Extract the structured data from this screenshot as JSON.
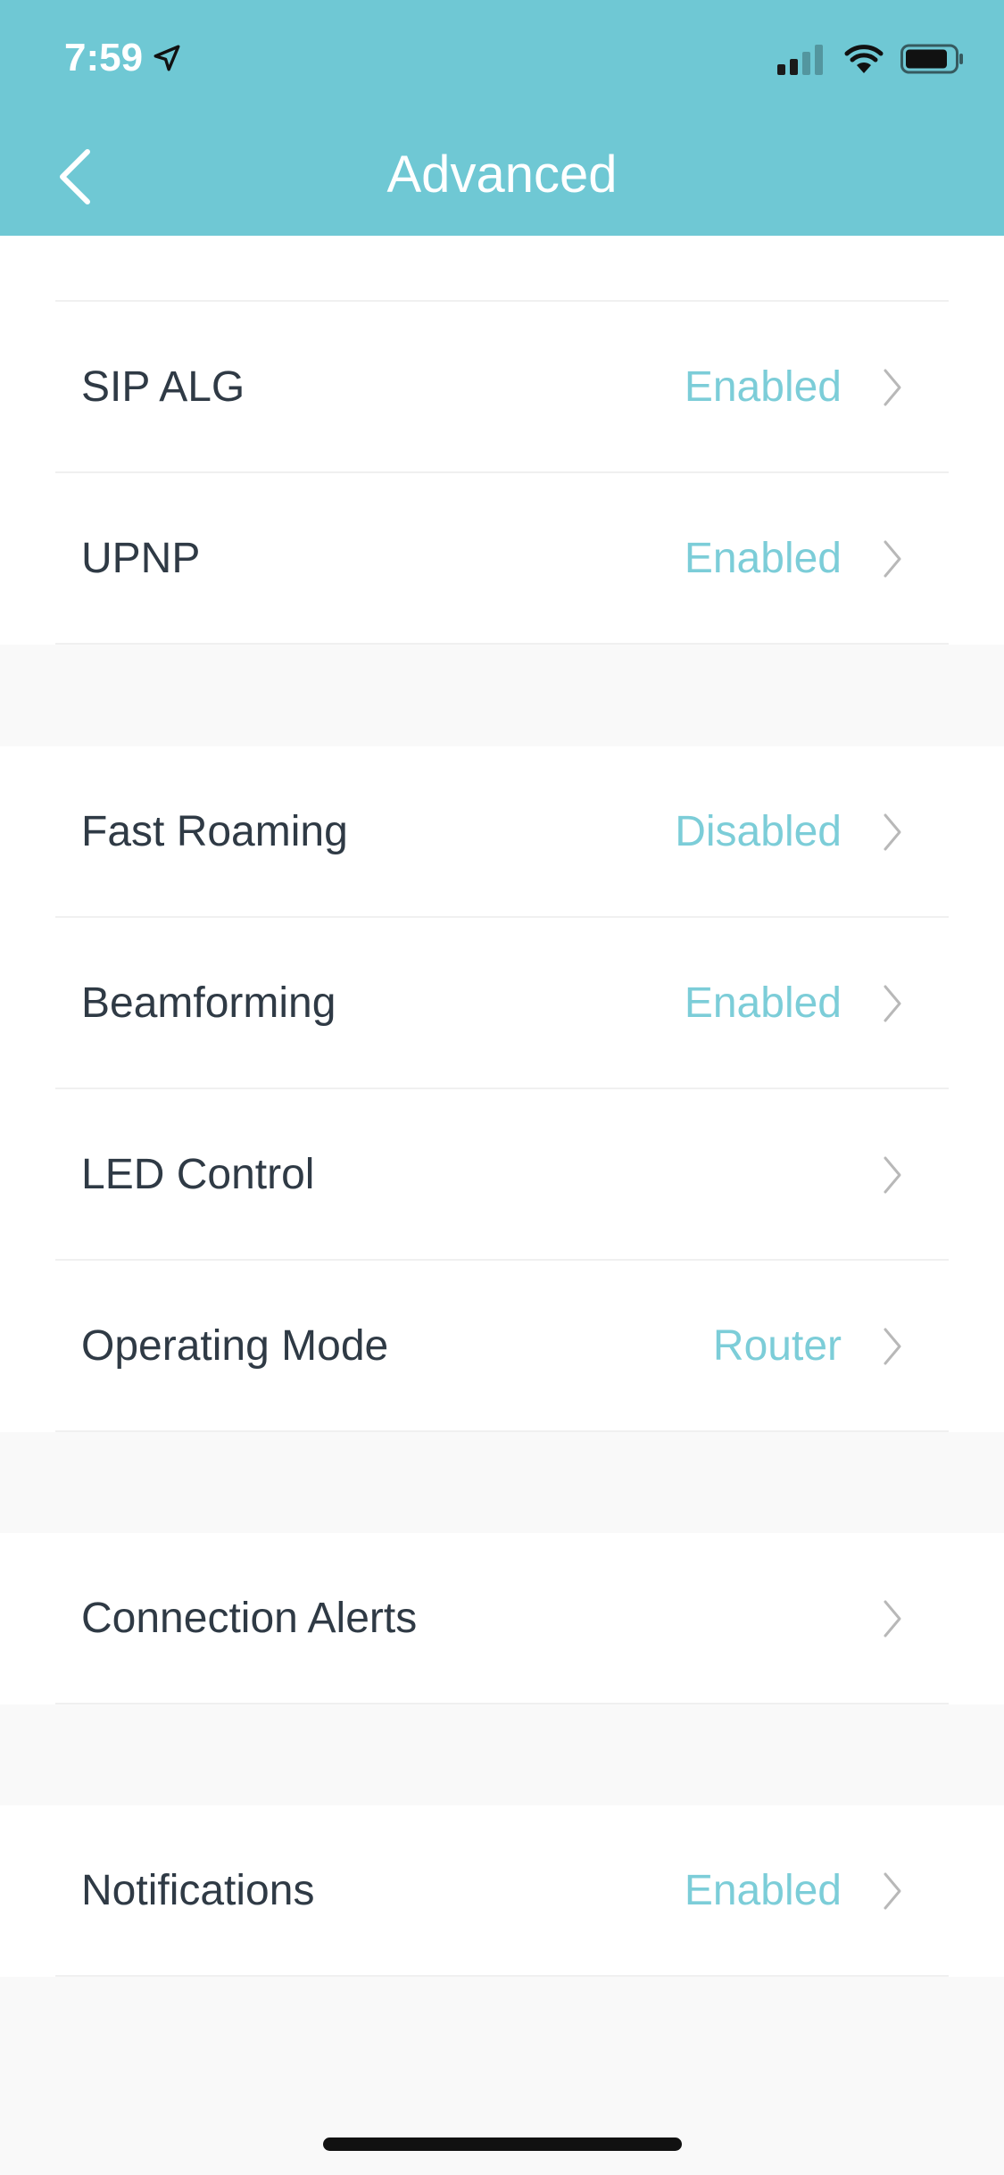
{
  "status_bar": {
    "time": "7:59"
  },
  "header": {
    "title": "Advanced"
  },
  "sections": [
    {
      "rows": [
        {
          "label": "",
          "value": ""
        },
        {
          "label": "SIP ALG",
          "value": "Enabled"
        },
        {
          "label": "UPNP",
          "value": "Enabled"
        }
      ]
    },
    {
      "rows": [
        {
          "label": "Fast Roaming",
          "value": "Disabled"
        },
        {
          "label": "Beamforming",
          "value": "Enabled"
        },
        {
          "label": "LED Control",
          "value": ""
        },
        {
          "label": "Operating Mode",
          "value": "Router"
        }
      ]
    },
    {
      "rows": [
        {
          "label": "Connection Alerts",
          "value": ""
        }
      ]
    },
    {
      "rows": [
        {
          "label": "Notifications",
          "value": "Enabled"
        }
      ]
    }
  ],
  "colors": {
    "header_bg": "#6fc8d4",
    "value_text": "#7ccdd8",
    "label_text": "#2f3a45",
    "page_bg": "#f9f9f9"
  }
}
